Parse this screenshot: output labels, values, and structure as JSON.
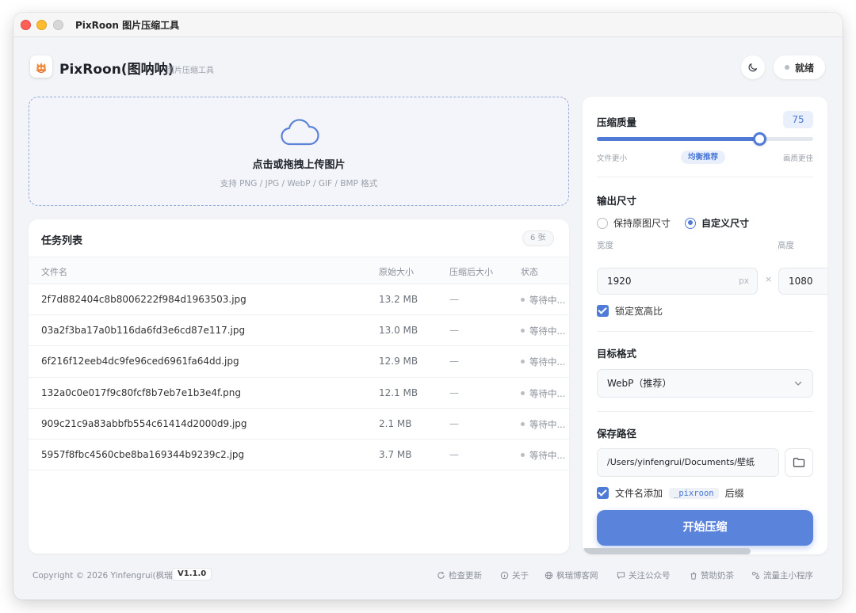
{
  "window": {
    "title": "PixRoon 图片压缩工具"
  },
  "header": {
    "app_name": "PixRoon(图呐呐)",
    "app_subtitle": "图片压缩工具",
    "status": "就绪"
  },
  "upload": {
    "title": "点击或拖拽上传图片",
    "hint": "支持 PNG / JPG / WebP / GIF / BMP 格式"
  },
  "tasks": {
    "title": "任务列表",
    "count": "6 张",
    "columns": {
      "name": "文件名",
      "original": "原始大小",
      "compressed": "压缩后大小",
      "status": "状态"
    },
    "rows": [
      {
        "name": "2f7d882404c8b8006222f984d1963503.jpg",
        "original": "13.2 MB",
        "compressed": "—",
        "status": "等待中..."
      },
      {
        "name": "03a2f3ba17a0b116da6fd3e6cd87e117.jpg",
        "original": "13.0 MB",
        "compressed": "—",
        "status": "等待中..."
      },
      {
        "name": "6f216f12eeb4dc9fe96ced6961fa64dd.jpg",
        "original": "12.9 MB",
        "compressed": "—",
        "status": "等待中..."
      },
      {
        "name": "132a0c0e017f9c80fcf8b7eb7e1b3e4f.png",
        "original": "12.1 MB",
        "compressed": "—",
        "status": "等待中..."
      },
      {
        "name": "909c21c9a83abbfb554c61414d2000d9.jpg",
        "original": "2.1 MB",
        "compressed": "—",
        "status": "等待中..."
      },
      {
        "name": "5957f8fbc4560cbe8ba169344b9239c2.jpg",
        "original": "3.7 MB",
        "compressed": "—",
        "status": "等待中..."
      }
    ]
  },
  "settings": {
    "quality": {
      "label": "压缩质量",
      "value": "75",
      "fraction": 0.75,
      "min_label": "文件更小",
      "mid_label": "均衡推荐",
      "max_label": "画质更佳"
    },
    "size": {
      "label": "输出尺寸",
      "keep_original": "保持原图尺寸",
      "custom": "自定义尺寸",
      "selected": "custom",
      "width_label": "宽度",
      "height_label": "高度",
      "width": "1920",
      "height": "1080",
      "unit": "px",
      "times": "×",
      "lock_ratio": "锁定宽高比"
    },
    "format": {
      "label": "目标格式",
      "value": "WebP（推荐）"
    },
    "save": {
      "label": "保存路径",
      "path": "/Users/yinfengrui/Documents/壁纸",
      "suffix_prefix": "文件名添加",
      "suffix": "_pixroon",
      "suffix_after": "后缀"
    },
    "start_button": "开始压缩"
  },
  "footer": {
    "copyright": "Copyright © 2026 Yinfengrui(枫瑞)",
    "version": "V1.1.0",
    "links": [
      "检查更新",
      "关于",
      "枫瑞博客网",
      "关注公众号",
      "赞助奶茶",
      "流量主小程序"
    ]
  },
  "colors": {
    "accent": "#4f7ad6",
    "window_bg": "#f3f4f7"
  }
}
